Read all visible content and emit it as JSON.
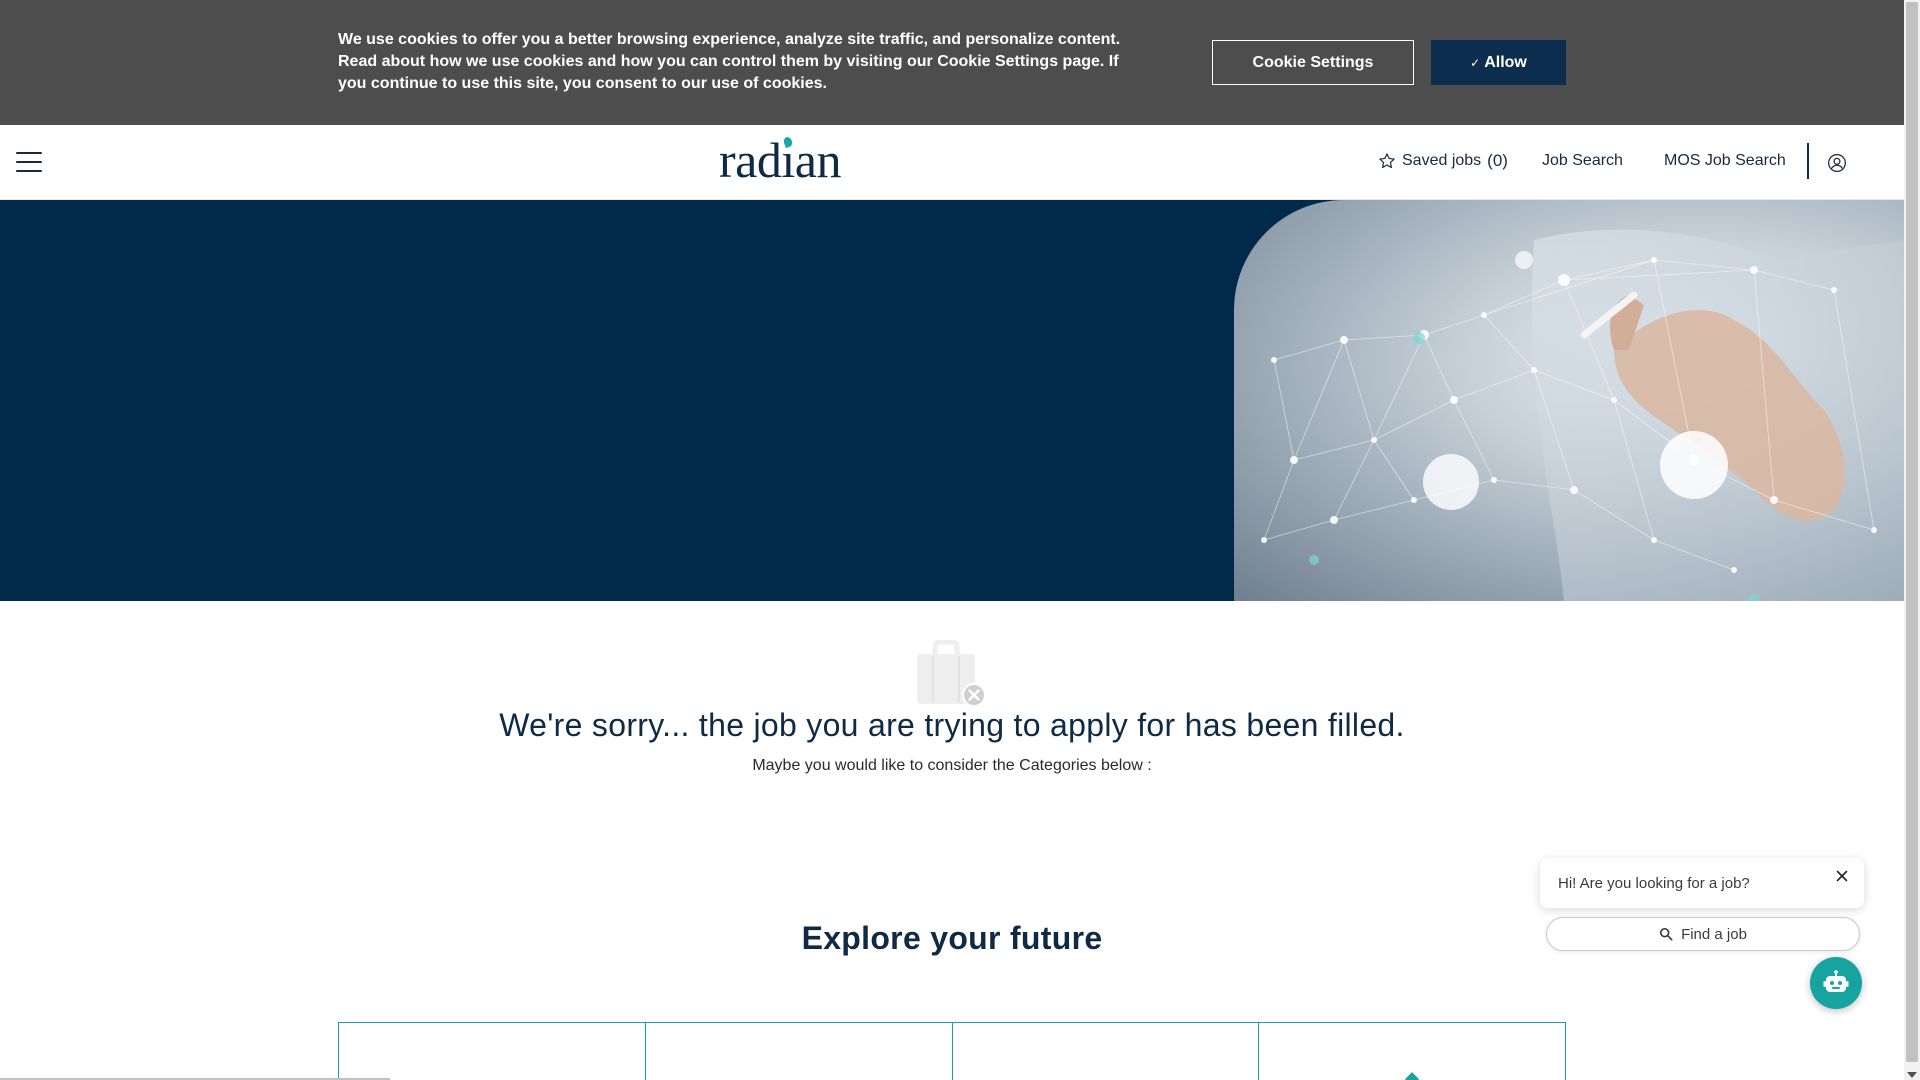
{
  "cookie_banner": {
    "text": "We use cookies to offer you a better browsing experience, analyze site traffic, and personalize content. Read about how we use cookies and how you can control them by visiting our Cookie Settings page. If you continue to use this site, you consent to our use of cookies.",
    "settings_label": "Cookie Settings",
    "allow_label": "Allow",
    "allow_check": "✓"
  },
  "header": {
    "logo_pre": "rad",
    "logo_i": "ı",
    "logo_post": "an",
    "saved_jobs_label": "Saved jobs",
    "saved_jobs_count": "(0)",
    "job_search_label": "Job Search",
    "mos_job_search_label": "MOS Job Search"
  },
  "main": {
    "sorry_title": "We're sorry... the job you are trying to apply for has been filled.",
    "sorry_subtitle": "Maybe you would like to consider the Categories below :",
    "explore_title": "Explore your future"
  },
  "categories": [
    "",
    "",
    "",
    ""
  ],
  "chat": {
    "greeting": "Hi! Are you looking for a job?",
    "find_label": "Find a job"
  },
  "colors": {
    "navy": "#012a4a",
    "teal": "#17a4a1",
    "banner_gray": "#4d4d4d",
    "allow_bg": "#0c2d4e"
  },
  "icons": {
    "menu": "hamburger-menu-icon",
    "saved": "star-outline-icon",
    "user": "user-circle-icon",
    "filled": "briefcase-x-icon",
    "close": "close-icon",
    "search": "search-icon",
    "bot": "robot-icon"
  }
}
